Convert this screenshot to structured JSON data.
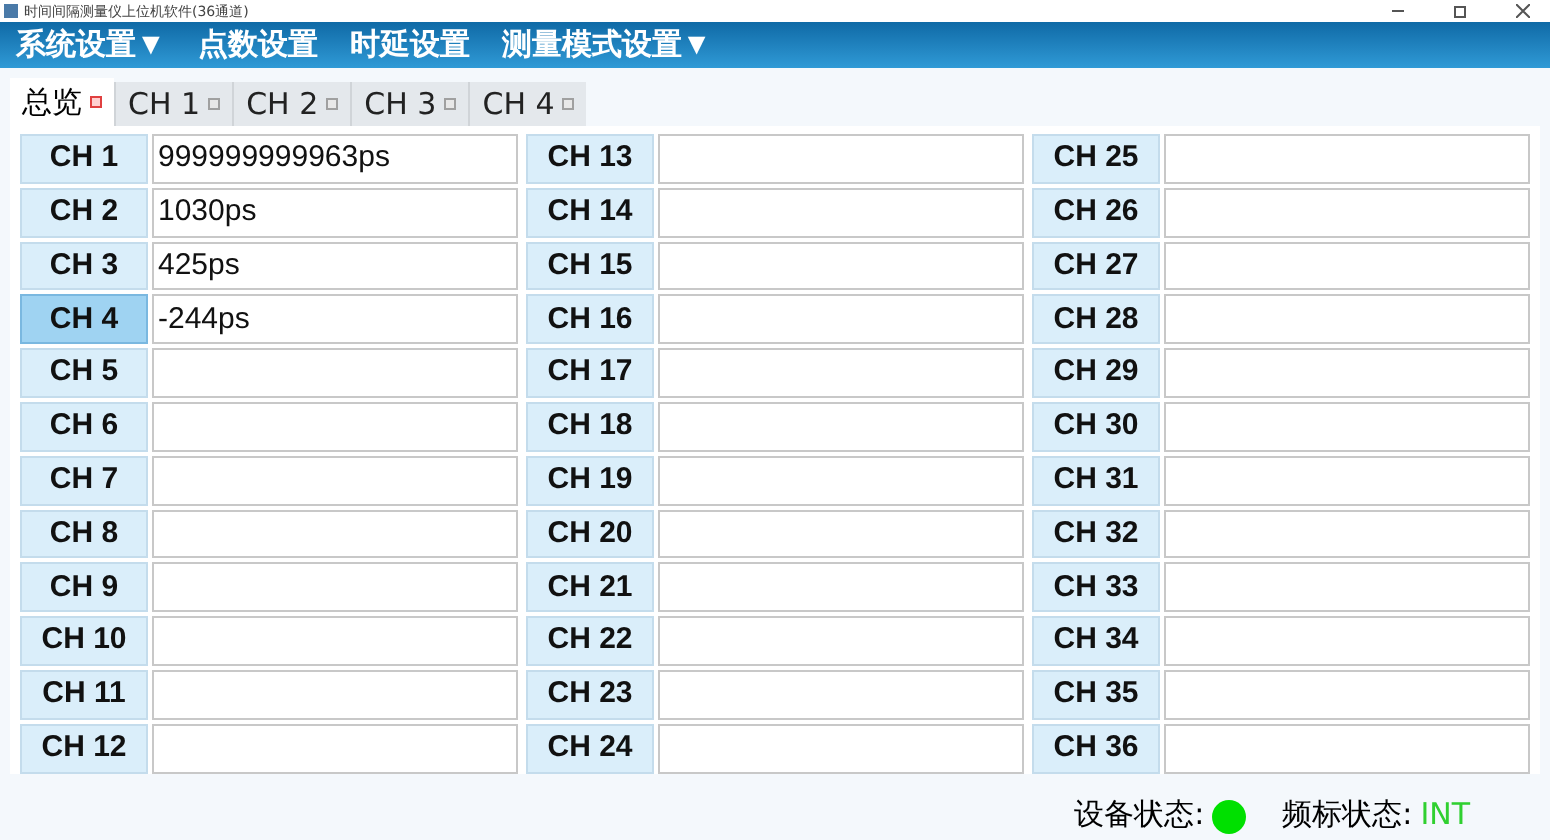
{
  "window": {
    "title": "时间间隔测量仪上位机软件(36通道)"
  },
  "menu": [
    {
      "label": "系统设置▼"
    },
    {
      "label": "点数设置"
    },
    {
      "label": "时延设置"
    },
    {
      "label": "测量模式设置▼"
    }
  ],
  "tabs": [
    {
      "label": "总览",
      "selected": true
    },
    {
      "label": "CH 1",
      "selected": false
    },
    {
      "label": "CH 2",
      "selected": false
    },
    {
      "label": "CH 3",
      "selected": false
    },
    {
      "label": "CH 4",
      "selected": false
    }
  ],
  "channels": [
    {
      "name": "CH 1",
      "value": "999999999963ps",
      "selected": false
    },
    {
      "name": "CH 2",
      "value": "1030ps",
      "selected": false
    },
    {
      "name": "CH 3",
      "value": "425ps",
      "selected": false
    },
    {
      "name": "CH 4",
      "value": "-244ps",
      "selected": true
    },
    {
      "name": "CH 5",
      "selected": false
    },
    {
      "name": "CH 6",
      "selected": false
    },
    {
      "name": "CH 7",
      "selected": false
    },
    {
      "name": "CH 8",
      "selected": false
    },
    {
      "name": "CH 9",
      "selected": false
    },
    {
      "name": "CH 10",
      "selected": false
    },
    {
      "name": "CH 11",
      "selected": false
    },
    {
      "name": "CH 12",
      "selected": false
    },
    {
      "name": "CH 13",
      "selected": false
    },
    {
      "name": "CH 14",
      "selected": false
    },
    {
      "name": "CH 15",
      "selected": false
    },
    {
      "name": "CH 16",
      "selected": false
    },
    {
      "name": "CH 17",
      "selected": false
    },
    {
      "name": "CH 18",
      "selected": false
    },
    {
      "name": "CH 19",
      "selected": false
    },
    {
      "name": "CH 20",
      "selected": false
    },
    {
      "name": "CH 21",
      "selected": false
    },
    {
      "name": "CH 22",
      "selected": false
    },
    {
      "name": "CH 23",
      "selected": false
    },
    {
      "name": "CH 24",
      "selected": false
    },
    {
      "name": "CH 25",
      "selected": false
    },
    {
      "name": "CH 26",
      "selected": false
    },
    {
      "name": "CH 27",
      "selected": false
    },
    {
      "name": "CH 28",
      "selected": false
    },
    {
      "name": "CH 29",
      "selected": false
    },
    {
      "name": "CH 30",
      "selected": false
    },
    {
      "name": "CH 31",
      "selected": false
    },
    {
      "name": "CH 32",
      "selected": false
    },
    {
      "name": "CH 33",
      "selected": false
    },
    {
      "name": "CH 34",
      "selected": false
    },
    {
      "name": "CH 35",
      "selected": false
    },
    {
      "name": "CH 36",
      "selected": false
    }
  ],
  "status_bar": {
    "items": [
      {
        "kind": "dot",
        "label": "设备状态:",
        "color": "#00e000"
      },
      {
        "kind": "text",
        "label": "频标状态:",
        "value": "INT"
      }
    ]
  }
}
